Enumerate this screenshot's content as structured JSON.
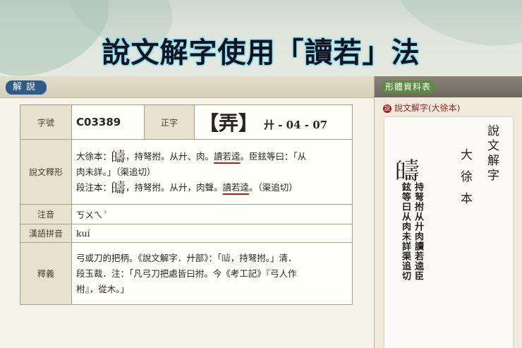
{
  "banner": {
    "headline": "說文解字使用「讀若」法"
  },
  "main": {
    "tab_label": "解說",
    "rows": {
      "zihao": {
        "label": "字號",
        "value": "C03389"
      },
      "zhengzi": {
        "label": "正字",
        "char": "【弄】",
        "part": "廾 - 04 - 07"
      },
      "shuowen": {
        "label": "說文釋形",
        "xu_prefix": "大徐本：",
        "seal_glyph": "𦦰",
        "xu_text_1": "，持弩拊。从廾、肉。",
        "xu_underline": "讀若逵",
        "xu_text_2": "。臣鉉等曰：「从",
        "xu_text_3": "肉未詳。」（渠追切）",
        "duan_prefix": "段注本：",
        "duan_text_1": "，持弩拊。从廾，肉聲。",
        "duan_underline": "讀若逵",
        "duan_text_2": "。（渠追切）"
      },
      "zhuyin": {
        "label": "注音",
        "value": "ㄎㄨㄟˊ"
      },
      "pinyin": {
        "label": "漢語拼音",
        "value": "kuí"
      },
      "shiyi": {
        "label": "釋義",
        "line1": "弓或刀的把柄。《說文解字．廾部》：「𦦰，持弩拊。」清．",
        "line2": "段玉裁．注：「凡弓刀把處皆曰拊。今《考工記》『弓人作",
        "line3": "柎』，從木。」"
      }
    }
  },
  "side": {
    "tab_label": "形體資料表",
    "source": "說文解字(大徐本)",
    "source_icon": "說",
    "scan": {
      "col_title": "說文解字",
      "col_edition": "大徐本",
      "col_main": "持弩拊从廾肉讀若逵臣",
      "col_side": "鉉等曰从肉未詳渠追切"
    }
  }
}
